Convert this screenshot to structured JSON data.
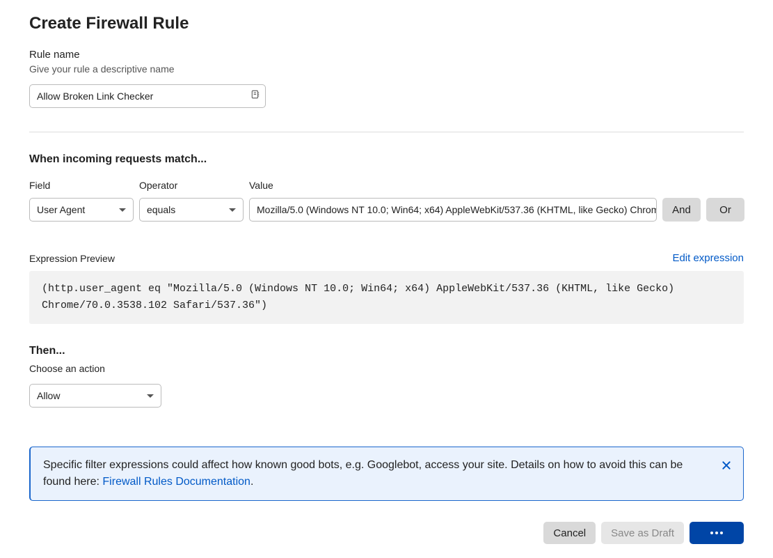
{
  "page": {
    "title": "Create Firewall Rule"
  },
  "rule_name": {
    "label": "Rule name",
    "helper": "Give your rule a descriptive name",
    "value": "Allow Broken Link Checker"
  },
  "match": {
    "heading": "When incoming requests match...",
    "field": {
      "label": "Field",
      "value": "User Agent"
    },
    "operator": {
      "label": "Operator",
      "value": "equals"
    },
    "value": {
      "label": "Value",
      "value": "Mozilla/5.0 (Windows NT 10.0; Win64; x64) AppleWebKit/537.36 (KHTML, like Gecko) Chrome/70.0.3538.102 Safari/537.36"
    },
    "and_label": "And",
    "or_label": "Or"
  },
  "preview": {
    "label": "Expression Preview",
    "edit_label": "Edit expression",
    "expression": "(http.user_agent eq \"Mozilla/5.0 (Windows NT 10.0; Win64; x64) AppleWebKit/537.36 (KHTML, like Gecko) Chrome/70.0.3538.102 Safari/537.36\")"
  },
  "then": {
    "heading": "Then...",
    "choose_label": "Choose an action",
    "action": "Allow"
  },
  "alert": {
    "text_before": "Specific filter expressions could affect how known good bots, e.g. Googlebot, access your site. Details on how to avoid this can be found here: ",
    "link_text": "Firewall Rules Documentation",
    "text_after": "."
  },
  "footer": {
    "cancel": "Cancel",
    "draft": "Save as Draft"
  }
}
